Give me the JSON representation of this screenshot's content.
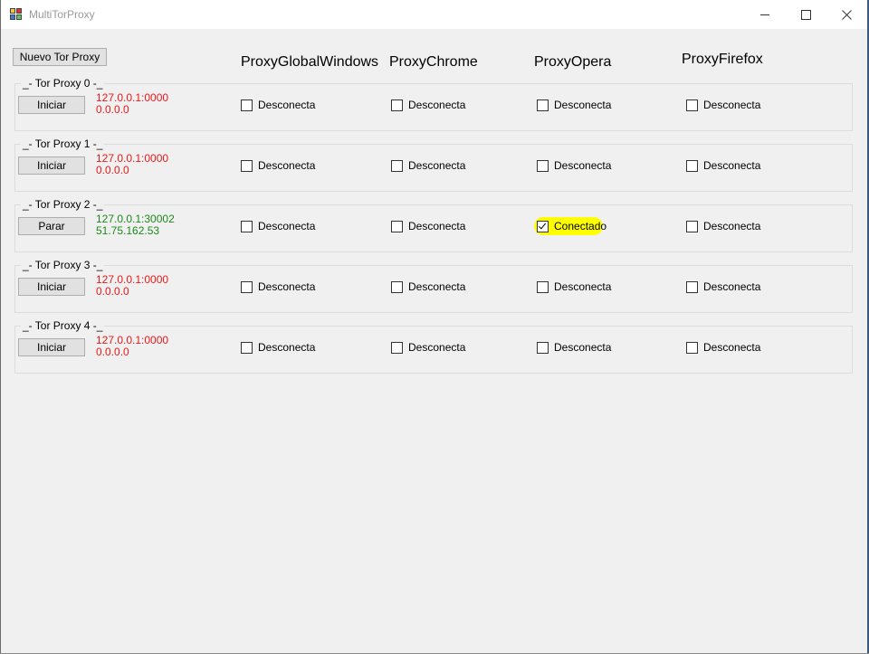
{
  "window": {
    "title": "MultiTorProxy"
  },
  "toolbar": {
    "new_proxy_label": "Nuevo Tor Proxy"
  },
  "columns": [
    "ProxyGlobalWindows",
    "ProxyChrome",
    "ProxyOpera",
    "ProxyFirefox"
  ],
  "proxies": [
    {
      "title": "_- Tor Proxy 0 -_",
      "button": "Iniciar",
      "address": "127.0.0.1:0000",
      "ip": "0.0.0.0",
      "status_color": "#e81a1a",
      "checks": [
        {
          "label": "Desconecta",
          "checked": false
        },
        {
          "label": "Desconecta",
          "checked": false
        },
        {
          "label": "Desconecta",
          "checked": false
        },
        {
          "label": "Desconecta",
          "checked": false
        }
      ]
    },
    {
      "title": "_- Tor Proxy 1 -_",
      "button": "Iniciar",
      "address": "127.0.0.1:0000",
      "ip": "0.0.0.0",
      "status_color": "#e81a1a",
      "checks": [
        {
          "label": "Desconecta",
          "checked": false
        },
        {
          "label": "Desconecta",
          "checked": false
        },
        {
          "label": "Desconecta",
          "checked": false
        },
        {
          "label": "Desconecta",
          "checked": false
        }
      ]
    },
    {
      "title": "_- Tor Proxy 2 -_",
      "button": "Parar",
      "address": "127.0.0.1:30002",
      "ip": "51.75.162.53",
      "status_color": "#1a8a1a",
      "checks": [
        {
          "label": "Desconecta",
          "checked": false
        },
        {
          "label": "Desconecta",
          "checked": false
        },
        {
          "label": "Conectado",
          "checked": true
        },
        {
          "label": "Desconecta",
          "checked": false
        }
      ]
    },
    {
      "title": "_- Tor Proxy 3 -_",
      "button": "Iniciar",
      "address": "127.0.0.1:0000",
      "ip": "0.0.0.0",
      "status_color": "#e81a1a",
      "checks": [
        {
          "label": "Desconecta",
          "checked": false
        },
        {
          "label": "Desconecta",
          "checked": false
        },
        {
          "label": "Desconecta",
          "checked": false
        },
        {
          "label": "Desconecta",
          "checked": false
        }
      ]
    },
    {
      "title": "_- Tor Proxy 4 -_",
      "button": "Iniciar",
      "address": "127.0.0.1:0000",
      "ip": "0.0.0.0",
      "status_color": "#e81a1a",
      "checks": [
        {
          "label": "Desconecta",
          "checked": false
        },
        {
          "label": "Desconecta",
          "checked": false
        },
        {
          "label": "Desconecta",
          "checked": false
        },
        {
          "label": "Desconecta",
          "checked": false
        }
      ]
    }
  ],
  "colors": {
    "disconnected": "#e81a1a",
    "connected": "#1a8a1a",
    "highlight": "#ffff00"
  }
}
